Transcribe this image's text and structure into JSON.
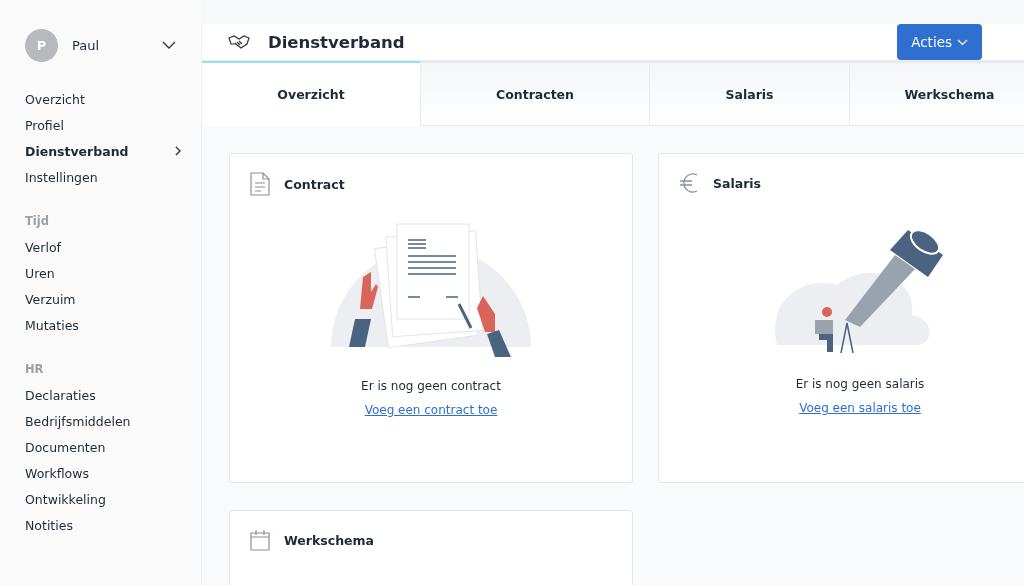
{
  "user": {
    "initial": "P",
    "name": "Paul"
  },
  "sidebar": {
    "groups": [
      {
        "items": [
          {
            "label": "Overzicht",
            "selected": false
          },
          {
            "label": "Profiel",
            "selected": false
          },
          {
            "label": "Dienstverband",
            "selected": true
          },
          {
            "label": "Instellingen",
            "selected": false
          }
        ]
      },
      {
        "heading": "Tijd",
        "items": [
          {
            "label": "Verlof",
            "selected": false
          },
          {
            "label": "Uren",
            "selected": false
          },
          {
            "label": "Verzuim",
            "selected": false
          },
          {
            "label": "Mutaties",
            "selected": false
          }
        ]
      },
      {
        "heading": "HR",
        "items": [
          {
            "label": "Declaraties",
            "selected": false
          },
          {
            "label": "Bedrijfsmiddelen",
            "selected": false
          },
          {
            "label": "Documenten",
            "selected": false
          },
          {
            "label": "Workflows",
            "selected": false
          },
          {
            "label": "Ontwikkeling",
            "selected": false
          },
          {
            "label": "Notities",
            "selected": false
          }
        ]
      }
    ]
  },
  "header": {
    "title": "Dienstverband",
    "action": "Acties"
  },
  "tabs": [
    {
      "label": "Overzicht",
      "selected": true
    },
    {
      "label": "Contracten",
      "selected": false
    },
    {
      "label": "Salaris",
      "selected": false
    },
    {
      "label": "Werkschema",
      "selected": false
    }
  ],
  "cards": [
    {
      "kind": "contract",
      "title": "Contract",
      "message": "Er is nog geen contract",
      "link": "Voeg een contract toe"
    },
    {
      "kind": "salary",
      "title": "Salaris",
      "message": "Er is nog geen salaris",
      "link": "Voeg een salaris toe"
    },
    {
      "kind": "schedule",
      "title": "Werkschema"
    }
  ]
}
